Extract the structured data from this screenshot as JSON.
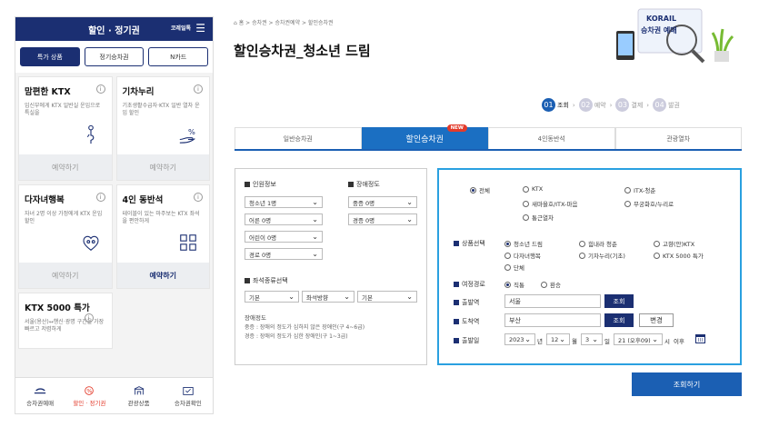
{
  "mobile": {
    "title": "할인 · 정기권",
    "brand_icon": "코레일톡",
    "menu_icon": "☰",
    "tabs": [
      {
        "label": "특가 상품"
      },
      {
        "label": "정기승차권"
      },
      {
        "label": "N카드"
      }
    ],
    "cards": [
      {
        "title": "맘편한 KTX",
        "desc": "임신부에게 KTX 일반실 운임으로 특실을",
        "btn": "예약하기"
      },
      {
        "title": "기차누리",
        "desc": "기초생활수급자·KTX 일반 열차 운임 할인",
        "btn": "예약하기"
      },
      {
        "title": "다자녀행복",
        "desc": "자녀 2명 이상 가정에게 KTX 운임 할인",
        "btn": "예약하기"
      },
      {
        "title": "4인 동반석",
        "desc": "테이블이 있는 마주보는 KTX 좌석을 편안하게",
        "btn": "예약하기"
      },
      {
        "title": "KTX 5000 특가",
        "desc": "서울(용산)↔행신·광명 구간을 가장 빠르고 저렴하게"
      }
    ],
    "nav": [
      {
        "label": "승차권예매"
      },
      {
        "label": "할인 · 정기권"
      },
      {
        "label": "관광상품"
      },
      {
        "label": "승차권확인"
      }
    ]
  },
  "breadcrumb": "홈 > 승차권 > 승차권예약 > 할인승차권",
  "page_title": "할인승차권_청소년 드림",
  "banner": {
    "logo": "KORAIL",
    "text": "승차권 예매"
  },
  "steps": [
    {
      "num": "01",
      "label": "조회"
    },
    {
      "num": "02",
      "label": "예약"
    },
    {
      "num": "03",
      "label": "결제"
    },
    {
      "num": "04",
      "label": "발권"
    }
  ],
  "tabs": [
    {
      "label": "일반승차권"
    },
    {
      "label": "할인승차권",
      "badge": "NEW"
    },
    {
      "label": "4인동반석"
    },
    {
      "label": "관광열차"
    }
  ],
  "left": {
    "passenger_heading": "인원정보",
    "disability_heading": "장애정도",
    "passengers": [
      "청소년 1명",
      "어른 0명",
      "어린이 0명",
      "경로 0명"
    ],
    "disabilities": [
      "중증 0명",
      "경증 0명"
    ],
    "seat_heading": "좌석종류선택",
    "seat_options": [
      "기본",
      "좌석방향",
      "기본"
    ],
    "note_title": "장애정도",
    "note_lines": [
      "중증 : 장애의 정도가 심하지 않은 장애인(구 4~6급)",
      "경증 : 장애의 정도가 심한 장애인(구 1~3급)"
    ]
  },
  "right": {
    "train_types": [
      "전체",
      "KTX",
      "ITX-청춘",
      "새마을호/ITX-마음",
      "무궁화호/누리로",
      "통근열차"
    ],
    "product_label": "상품선택",
    "products": [
      "청소년 드림",
      "힘내라 청춘",
      "고향(안)KTX",
      "다자녀행복",
      "기차누리(기초)",
      "KTX 5000 특가",
      "단체"
    ],
    "trip_label": "여정경로",
    "trip_options": [
      "직통",
      "환승"
    ],
    "dep_label": "출발역",
    "dep_value": "서울",
    "arr_label": "도착역",
    "arr_value": "부산",
    "lookup_btn": "조회",
    "swap_btn": "변경",
    "date_label": "출발일",
    "date_year": "2023",
    "year_suffix": "년",
    "date_month": "12",
    "month_suffix": "월",
    "date_day": "3",
    "day_suffix": "일",
    "date_time": "21 (오후09)",
    "time_suffix": "시",
    "time_extra": "이후"
  },
  "search_btn": "조회하기"
}
